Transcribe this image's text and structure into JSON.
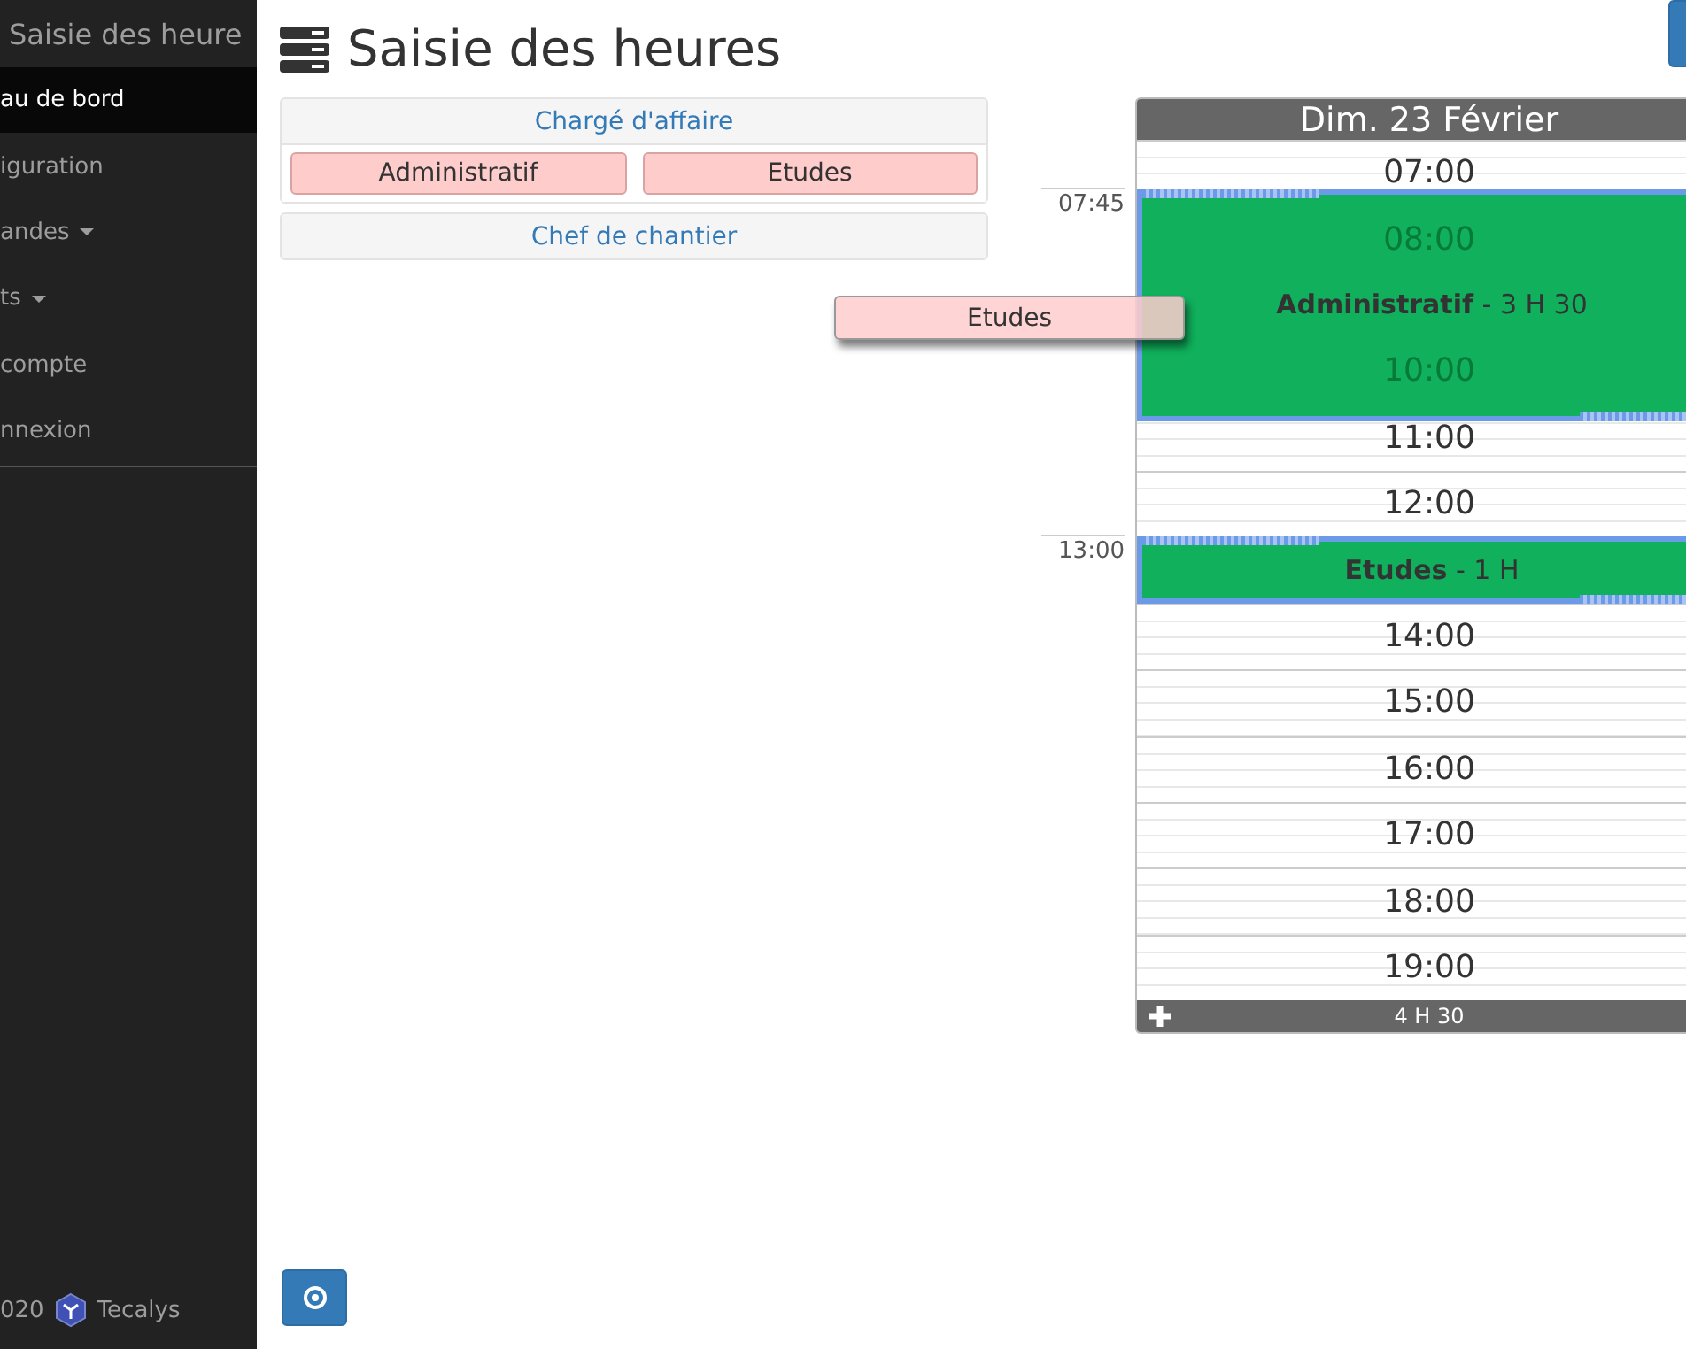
{
  "sidebar": {
    "brand": "Saisie des heure",
    "items": [
      {
        "label": "au de bord",
        "selected": true,
        "caret": false
      },
      {
        "label": "iguration",
        "selected": false,
        "caret": false
      },
      {
        "label": "andes",
        "selected": false,
        "caret": true
      },
      {
        "label": "ts",
        "selected": false,
        "caret": true
      },
      {
        "label": "compte",
        "selected": false,
        "caret": false
      },
      {
        "label": "nnexion",
        "selected": false,
        "caret": false
      }
    ],
    "footer": {
      "year": "020",
      "company": "Tecalys"
    }
  },
  "page": {
    "title": "Saisie des heures"
  },
  "groups": [
    {
      "title": "Chargé d'affaire",
      "tasks": [
        "Administratif",
        "Etudes"
      ]
    },
    {
      "title": "Chef de chantier"
    }
  ],
  "dragged_task": "Etudes",
  "calendar": {
    "day": "Dim. 23 Février",
    "slots": [
      {
        "label": "07:00",
        "covered": false
      },
      {
        "label": "08:00",
        "covered": true
      },
      {
        "label": "10:00",
        "covered": true
      },
      {
        "label": "11:00",
        "covered": false
      },
      {
        "label": "12:00",
        "covered": false
      },
      {
        "label": "14:00",
        "covered": false
      },
      {
        "label": "15:00",
        "covered": false
      },
      {
        "label": "16:00",
        "covered": false
      },
      {
        "label": "17:00",
        "covered": false
      },
      {
        "label": "18:00",
        "covered": false
      },
      {
        "label": "19:00",
        "covered": false
      }
    ],
    "events": [
      {
        "start": "07:45",
        "title": "**Administratif** - 3 H 30"
      },
      {
        "start": "13:00",
        "title": "**Etudes** - 1 H"
      }
    ],
    "total": "4 H 30"
  }
}
